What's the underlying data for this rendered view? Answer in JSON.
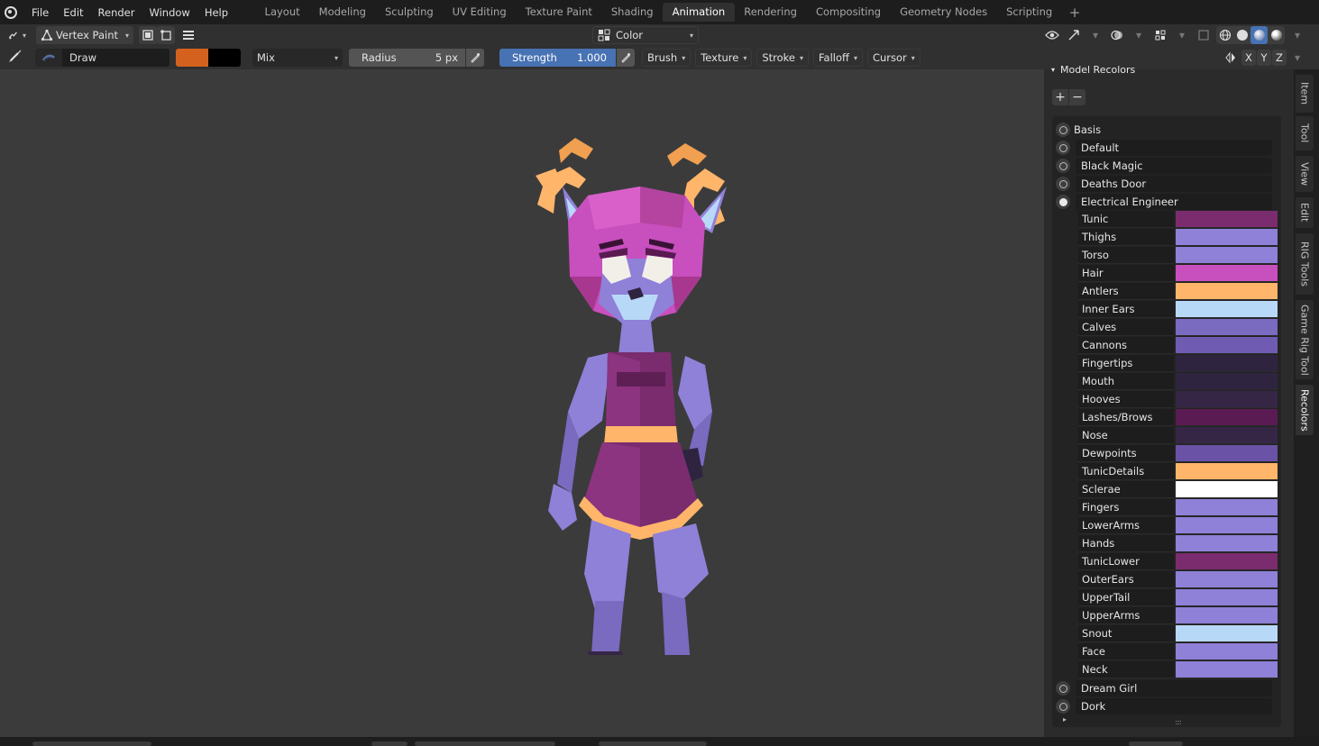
{
  "menubar": {
    "items": [
      "File",
      "Edit",
      "Render",
      "Window",
      "Help"
    ]
  },
  "workspaces": {
    "tabs": [
      "Layout",
      "Modeling",
      "Sculpting",
      "UV Editing",
      "Texture Paint",
      "Shading",
      "Animation",
      "Rendering",
      "Compositing",
      "Geometry Nodes",
      "Scripting"
    ],
    "active": "Animation",
    "add_label": "+"
  },
  "header": {
    "mode": "Vertex Paint",
    "color_mode": "Color"
  },
  "tool_settings": {
    "brush_name": "Draw",
    "primary_color": "#d4621e",
    "secondary_color": "#000000",
    "blend_mode": "Mix",
    "radius_label": "Radius",
    "radius_value": "5 px",
    "strength_label": "Strength",
    "strength_value": "1.000",
    "popovers": [
      "Brush",
      "Texture",
      "Stroke",
      "Falloff",
      "Cursor"
    ],
    "mirror_axes": [
      "X",
      "Y",
      "Z"
    ]
  },
  "panel": {
    "title": "Model Recolors",
    "add_label": "+",
    "remove_label": "−",
    "basis_label": "Basis",
    "presets_before": [
      "Default",
      "Black Magic",
      "Deaths Door"
    ],
    "active_preset": "Electrical Engineer",
    "colors": [
      {
        "name": "Tunic",
        "hex": "#7a2c6e"
      },
      {
        "name": "Thighs",
        "hex": "#8f80d8"
      },
      {
        "name": "Torso",
        "hex": "#8f80d8"
      },
      {
        "name": "Hair",
        "hex": "#c84fbe"
      },
      {
        "name": "Antlers",
        "hex": "#ffb56a"
      },
      {
        "name": "Inner Ears",
        "hex": "#b8d8f8"
      },
      {
        "name": "Calves",
        "hex": "#7a6ac0"
      },
      {
        "name": "Cannons",
        "hex": "#6f5cb2"
      },
      {
        "name": "Fingertips",
        "hex": "#2f2440"
      },
      {
        "name": "Mouth",
        "hex": "#2f2440"
      },
      {
        "name": "Hooves",
        "hex": "#352646"
      },
      {
        "name": "Lashes/Brows",
        "hex": "#5a1a52"
      },
      {
        "name": "Nose",
        "hex": "#352646"
      },
      {
        "name": "Dewpoints",
        "hex": "#6a52a6"
      },
      {
        "name": "TunicDetails",
        "hex": "#ffb56a"
      },
      {
        "name": "Sclerae",
        "hex": "#ffffff"
      },
      {
        "name": "Fingers",
        "hex": "#8f80d8"
      },
      {
        "name": "LowerArms",
        "hex": "#8f80d8"
      },
      {
        "name": "Hands",
        "hex": "#8f80d8"
      },
      {
        "name": "TunicLower",
        "hex": "#7a2c6e"
      },
      {
        "name": "OuterEars",
        "hex": "#8f80d8"
      },
      {
        "name": "UpperTail",
        "hex": "#8f80d8"
      },
      {
        "name": "UpperArms",
        "hex": "#8f80d8"
      },
      {
        "name": "Snout",
        "hex": "#b8d8f8"
      },
      {
        "name": "Face",
        "hex": "#8f80d8"
      },
      {
        "name": "Neck",
        "hex": "#8f80d8"
      }
    ],
    "presets_after": [
      "Dream Girl",
      "Dork"
    ]
  },
  "sidebar_tabs": [
    "Item",
    "Tool",
    "View",
    "Edit",
    "RIG Tools",
    "Game Rig Tool",
    "Recolors"
  ],
  "active_sidebar_tab": "Recolors"
}
